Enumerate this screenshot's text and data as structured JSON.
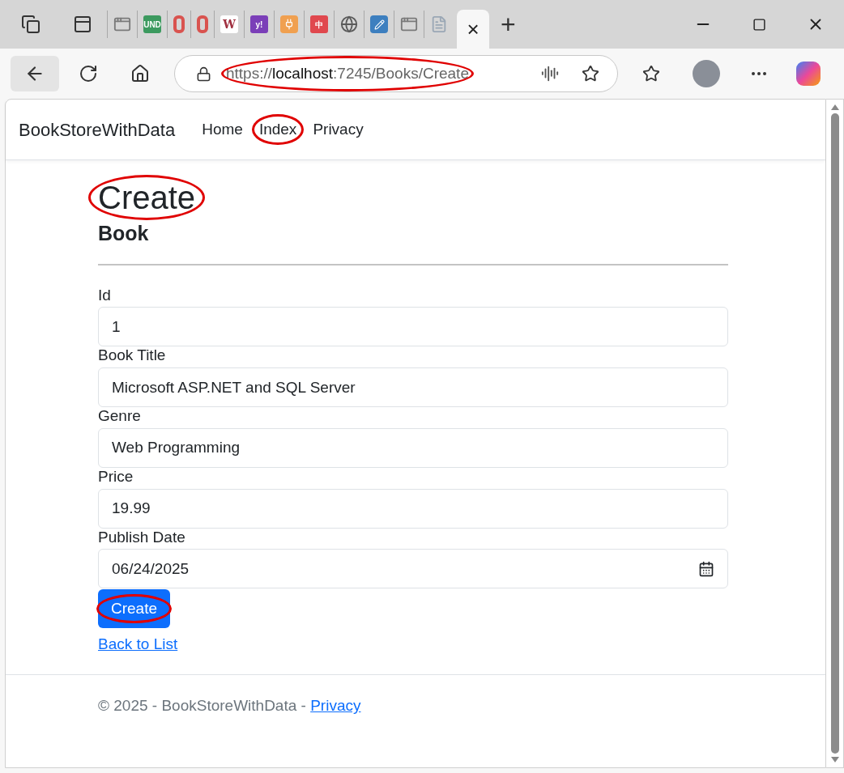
{
  "browser": {
    "tabs": [
      {
        "kind": "app",
        "color": "#7a7a7a"
      },
      {
        "kind": "letter",
        "glyph": "UND",
        "color": "#3c9a5f"
      },
      {
        "kind": "ring",
        "color": "#d9534f"
      },
      {
        "kind": "ring",
        "color": "#d9534f"
      },
      {
        "kind": "letter",
        "glyph": "W",
        "color": "#ffffff"
      },
      {
        "kind": "letter",
        "glyph": "y!",
        "color": "#7b3fb8"
      },
      {
        "kind": "plug",
        "color": "#f0a050"
      },
      {
        "kind": "letter",
        "glyph": "中",
        "color": "#e0484e"
      },
      {
        "kind": "globe",
        "color": "#5a5a5a"
      },
      {
        "kind": "edit",
        "color": "#3d7fbf"
      },
      {
        "kind": "app",
        "color": "#7a7a7a"
      },
      {
        "kind": "doc",
        "color": "#9aa7b5"
      }
    ],
    "active_tab": {
      "close": "×"
    },
    "new_tab": "+",
    "address": {
      "scheme": "https://",
      "host": "localhost",
      "rest": ":7245/Books/Create",
      "marked": true
    }
  },
  "site": {
    "brand": "BookStoreWithData",
    "nav": [
      {
        "label": "Home",
        "marked": false
      },
      {
        "label": "Index",
        "marked": true
      },
      {
        "label": "Privacy",
        "marked": false
      }
    ]
  },
  "page": {
    "title": "Create",
    "title_marked": true,
    "subtitle": "Book",
    "fields": [
      {
        "label": "Id",
        "value": "1",
        "kind": "text"
      },
      {
        "label": "Book Title",
        "value": "Microsoft ASP.NET and SQL Server",
        "kind": "text"
      },
      {
        "label": "Genre",
        "value": "Web Programming",
        "kind": "text"
      },
      {
        "label": "Price",
        "value": "19.99",
        "kind": "text"
      },
      {
        "label": "Publish Date",
        "value": "06/24/2025",
        "kind": "date"
      }
    ],
    "submit": {
      "label": "Create",
      "marked": true
    },
    "back_link": "Back to List"
  },
  "footer": {
    "text": "© 2025 - BookStoreWithData - ",
    "link": "Privacy"
  }
}
